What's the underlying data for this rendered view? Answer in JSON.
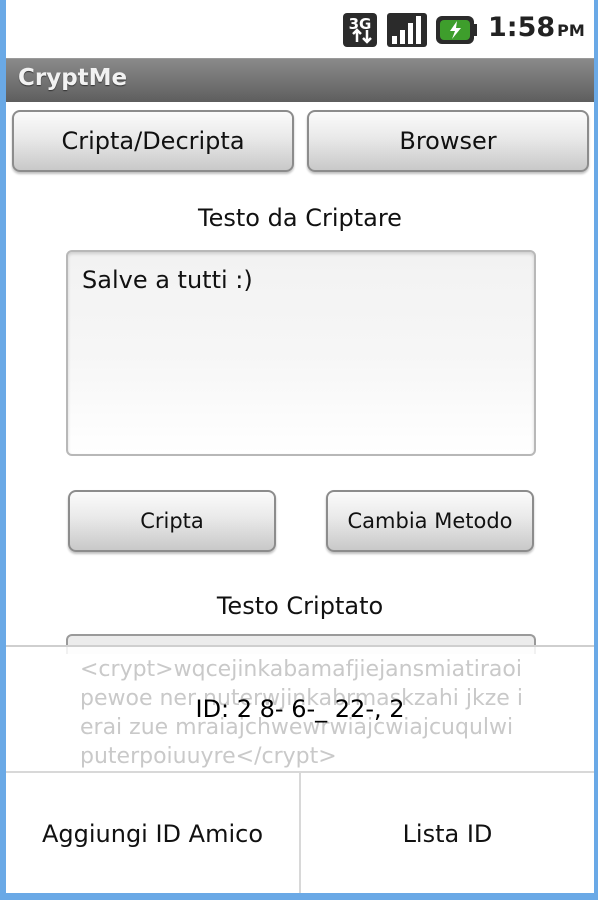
{
  "status_bar": {
    "network": "3G",
    "time": "1:58",
    "ampm": "PM"
  },
  "app": {
    "title": "CryptMe"
  },
  "tabs": {
    "left": "Cripta/Decripta",
    "right": "Browser"
  },
  "input_section": {
    "label": "Testo da Criptare",
    "value": "Salve a tutti :)"
  },
  "actions": {
    "encrypt": "Cripta",
    "change_method": "Cambia Metodo"
  },
  "output_section": {
    "label": "Testo Criptato",
    "value": "<crypt>wqcejinkabamafjiejansmiatiraoipewoe          ner   nuterwjinkabrmaskzahi jkze  ierai  zue  mraiajchwewrwiajcwiajcuqulwiputerpoiuuyre</crypt>"
  },
  "menu": {
    "id_text": "ID: 2  8-    6-_ 22-,   2",
    "add_friend": "Aggiungi ID Amico",
    "id_list": "Lista ID"
  }
}
